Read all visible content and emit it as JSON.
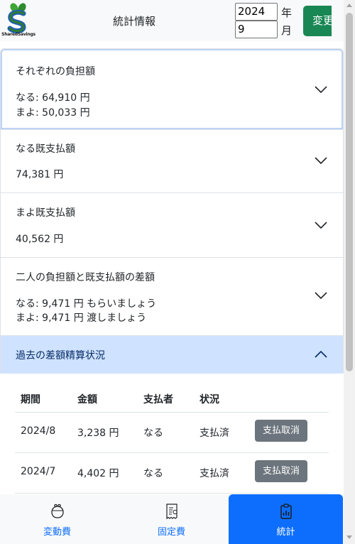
{
  "header": {
    "logo_text": "SharedSavings",
    "title": "統計情報",
    "year_value": "2024",
    "year_unit": "年",
    "month_value": "9",
    "month_unit": "月",
    "change_label": "変更"
  },
  "sections": {
    "burden": {
      "title": "それぞれの負担額",
      "line1": "なる: 64,910 円",
      "line2": "まよ: 50,033 円"
    },
    "naru_paid": {
      "title": "なる既支払額",
      "line1": "74,381 円"
    },
    "mayo_paid": {
      "title": "まよ既支払額",
      "line1": "40,562 円"
    },
    "diff": {
      "title": "二人の負担額と既支払額の差額",
      "line1": "なる: 9,471 円 もらいましょう",
      "line2": "まよ: 9,471 円 渡しましょう"
    },
    "history": {
      "title": "過去の差額精算状況"
    }
  },
  "table": {
    "headers": [
      "期間",
      "金額",
      "支払者",
      "状況"
    ],
    "rows": [
      {
        "period": "2024/8",
        "amount": "3,238 円",
        "payer": "なる",
        "status": "支払済",
        "action": "支払取消"
      },
      {
        "period": "2024/7",
        "amount": "4,402 円",
        "payer": "なる",
        "status": "支払済",
        "action": "支払取消"
      }
    ]
  },
  "nav": {
    "variable": "変動費",
    "fixed": "固定費",
    "stats": "統計"
  },
  "colors": {
    "primary": "#0d6efd",
    "success": "#198754",
    "secondary": "#6c757d",
    "accordion_active": "#cfe2ff"
  }
}
